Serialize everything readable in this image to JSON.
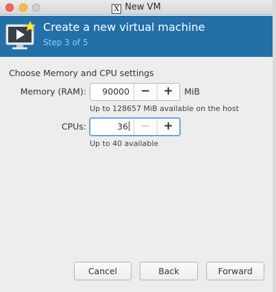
{
  "window": {
    "title": "New VM",
    "app_icon": "x11-icon"
  },
  "header": {
    "title": "Create a new virtual machine",
    "step": "Step 3 of 5",
    "icon": "vm-screen-icon"
  },
  "section": {
    "heading": "Choose Memory and CPU settings"
  },
  "memory": {
    "label": "Memory (RAM):",
    "value": "90000",
    "unit": "MiB",
    "hint": "Up to 128657 MiB available on the host",
    "minus": "−",
    "plus": "+"
  },
  "cpus": {
    "label": "CPUs:",
    "value": "36",
    "hint": "Up to 40 available",
    "minus": "−",
    "plus": "+"
  },
  "buttons": {
    "cancel": "Cancel",
    "back": "Back",
    "forward": "Forward"
  },
  "colors": {
    "header_bg": "#236fa8",
    "step_text": "#8ecff4",
    "close": "#fc605c",
    "minimize": "#fdbc40"
  }
}
